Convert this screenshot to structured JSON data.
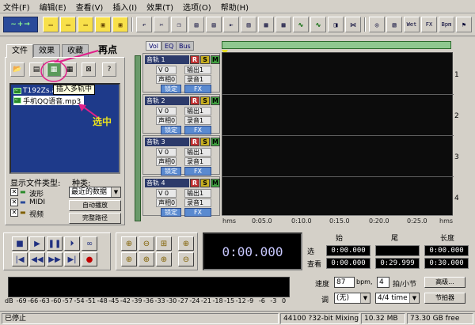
{
  "menu": [
    "文件(F)",
    "编辑(E)",
    "查看(V)",
    "插入(I)",
    "效果(T)",
    "选项(O)",
    "帮助(H)"
  ],
  "toolbar": {
    "logo": "~+→",
    "buttons_right": [
      "Wet",
      "FX",
      "Bpm"
    ]
  },
  "left_panel": {
    "tabs": [
      "文件",
      "效果",
      "收藏"
    ],
    "annotation_again": "再点",
    "tooltip": "插入多轨中",
    "files": [
      "T192Zs.a",
      "手机QQ语音.mp3"
    ],
    "annotation_selected": "选中",
    "filetype_label": "显示文件类型:",
    "type_label": "种类:",
    "checkboxes": [
      "波形",
      "MIDI",
      "视频"
    ],
    "sort_value": "最近的数据",
    "btn_autoplay": "自动播放",
    "btn_fullpath": "完整路径"
  },
  "track_header": {
    "tabs": [
      "Vol",
      "EQ",
      "Bus"
    ],
    "tracks": [
      {
        "name": "音轨 1",
        "vol": "V 0",
        "pan": "声相0",
        "out": "输出1",
        "rec": "录音1",
        "lock": "锁定"
      },
      {
        "name": "音轨 2",
        "vol": "V 0",
        "pan": "声相0",
        "out": "输出1",
        "rec": "录音1",
        "lock": "锁定"
      },
      {
        "name": "音轨 3",
        "vol": "V 0",
        "pan": "声相0",
        "out": "输出1",
        "rec": "录音1",
        "lock": "锁定"
      },
      {
        "name": "音轨 4",
        "vol": "V 0",
        "pan": "声相0",
        "out": "输出1",
        "rec": "录音1",
        "lock": "锁定"
      }
    ],
    "rsm": [
      "R",
      "S",
      "M"
    ],
    "fx": "FX"
  },
  "wave": {
    "track_numbers": [
      "1",
      "2",
      "3",
      "4"
    ],
    "ruler": [
      "hms",
      "0:05.0",
      "0:10.0",
      "0:15.0",
      "0:20.0",
      "0:25.0",
      "hms"
    ]
  },
  "transport_time": "0:00.000",
  "time_grid": {
    "headers": [
      "始",
      "尾",
      "长度"
    ],
    "row_select": "选",
    "row_view": "查看",
    "select": [
      "0:00.000",
      "",
      "0:00.000"
    ],
    "view": [
      "0:00.000",
      "0:29.999",
      "0:30.000"
    ]
  },
  "level_meter": {
    "ticks": [
      "dB",
      "-69",
      "-66",
      "-63",
      "-60",
      "-57",
      "-54",
      "-51",
      "-48",
      "-45",
      "-42",
      "-39",
      "-36",
      "-33",
      "-30",
      "-27",
      "-24",
      "-21",
      "-18",
      "-15",
      "-12",
      "-9",
      "-6",
      "-3",
      "0"
    ]
  },
  "tempo": {
    "speed_label": "速度",
    "speed_value": "87",
    "bpm_label": "bpm,",
    "beats_value": "4",
    "beats_label": "拍/小节",
    "advanced_button": "高级...",
    "key_label": "调",
    "key_value": "(无)",
    "time_sig": "4/4 time",
    "metronome_button": "节拍器"
  },
  "status": {
    "state": "已停止",
    "format": "44100 ?32-bit Mixing",
    "memory": "10.32 MB",
    "disk": "73.30 GB free"
  }
}
